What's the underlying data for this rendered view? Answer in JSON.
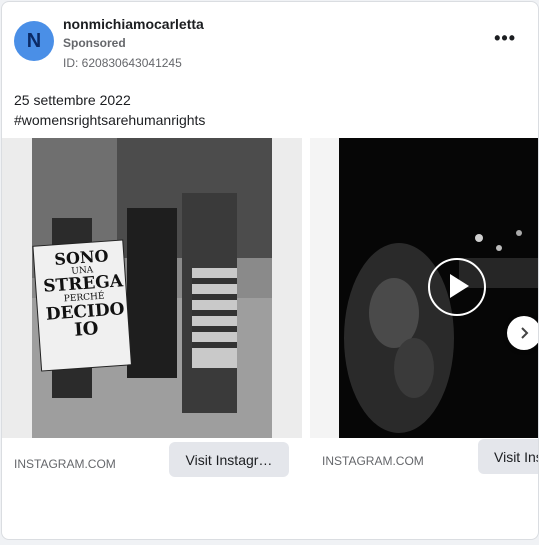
{
  "ad": {
    "avatar_letter": "N",
    "username": "nonmichiamocarletta",
    "sponsored_label": "Sponsored",
    "ad_id": "ID: 620830643041245",
    "more_label": "•••",
    "date_text": "25 settembre 2022",
    "hashtag_text": "#womensrightsarehumanrights"
  },
  "carousel": {
    "cards": [
      {
        "domain": "INSTAGRAM.COM",
        "cta_label": "Visit Instagr…",
        "image_description_icon": "photo-icon",
        "sign_lines": [
          "SONO",
          "UNA",
          "STREGA",
          "PERCHÉ",
          "DECIDO",
          "IO"
        ]
      },
      {
        "domain": "INSTAGRAM.COM",
        "cta_label": "Visit Ins",
        "image_description_icon": "video-icon"
      }
    ],
    "next_icon": "chevron-right-icon",
    "play_icon": "play-icon"
  },
  "colors": {
    "avatar_bg": "#4a8fe7",
    "button_bg": "#e4e6eb",
    "secondary_text": "#65676b"
  }
}
